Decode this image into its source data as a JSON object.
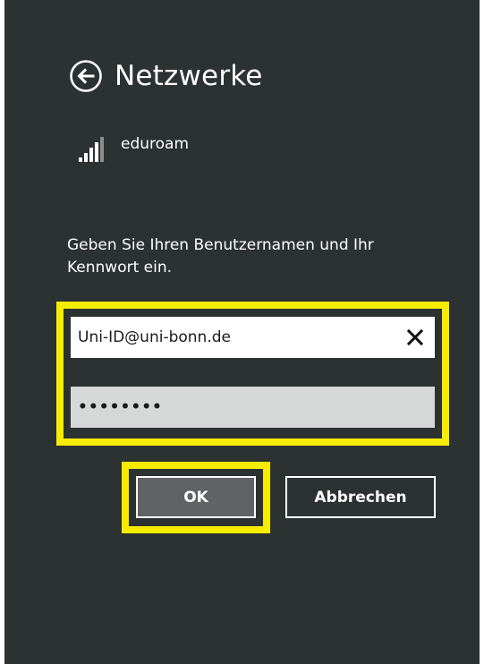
{
  "header": {
    "title": "Netzwerke",
    "back_icon": "back-arrow-circle-icon"
  },
  "network": {
    "ssid": "eduroam",
    "signal_icon": "wifi-signal-icon"
  },
  "prompt": {
    "text": "Geben Sie Ihren Benutzernamen und Ihr Kennwort ein."
  },
  "form": {
    "username_value": "Uni-ID@uni-bonn.de",
    "password_masked": "••••••••",
    "clear_icon": "close-icon"
  },
  "buttons": {
    "ok_label": "OK",
    "cancel_label": "Abbrechen"
  },
  "colors": {
    "panel_background": "#2c3132",
    "highlight": "#f5ec00",
    "ok_button_background": "#5f6363",
    "password_field_background": "#d6d7d7"
  }
}
